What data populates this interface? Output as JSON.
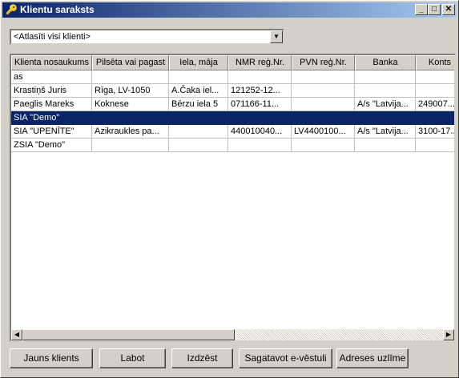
{
  "window": {
    "title": "Klientu saraksts",
    "min": "_",
    "max": "□",
    "close": "✕"
  },
  "filter": {
    "value": "<Atlasīti visi klienti>"
  },
  "table": {
    "headers": [
      "Klienta nosaukums",
      "Pilsēta vai pagast",
      "Iela, māja",
      "NMR reģ.Nr.",
      "PVN reģ.Nr.",
      "Banka",
      "Konts"
    ],
    "rows": [
      [
        "as",
        "",
        "",
        "",
        "",
        "",
        ""
      ],
      [
        "Krastiņš Juris",
        "Rīga, LV-1050",
        "A.Čaka iel...",
        "121252-12...",
        "",
        "",
        ""
      ],
      [
        "Paeglis Mareks",
        "Koknese",
        "Bērzu iela 5",
        "071166-11...",
        "",
        "A/s \"Latvija...",
        "249007..."
      ],
      [
        "SIA \"Demo\"",
        "",
        "",
        "",
        "",
        "",
        ""
      ],
      [
        "SIA \"UPENĪTE\"",
        "Azikraukles pa...",
        "",
        "440010040...",
        "LV4400100...",
        "A/s \"Latvija...",
        "3100-17..."
      ],
      [
        "ZSIA \"Demo\"",
        "",
        "",
        "",
        "",
        "",
        ""
      ]
    ],
    "selected_row": 3
  },
  "buttons": {
    "new": "Jauns klients",
    "edit": "Labot",
    "delete": "Izdzēst",
    "email": "Sagatavot  e-vēstuli",
    "address": "Adreses uzlīme"
  },
  "colors": {
    "selection": "#0a246a",
    "title_bar": "#0a246a"
  }
}
